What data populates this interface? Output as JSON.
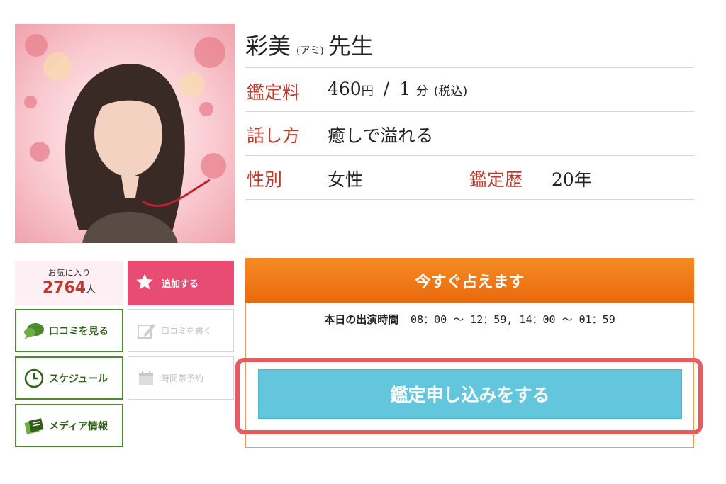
{
  "profile": {
    "name": "彩美",
    "reading": "(アミ)",
    "honorific": "先生",
    "fee_label": "鑑定料",
    "fee_price": "460",
    "fee_currency": "円",
    "fee_slash": "/",
    "fee_minutes": "1",
    "fee_unit": "分",
    "fee_tax": "(税込)",
    "style_label": "話し方",
    "style_value": "癒しで溢れる",
    "gender_label": "性別",
    "gender_value": "女性",
    "experience_label": "鑑定歴",
    "experience_value": "20年"
  },
  "favorites": {
    "label": "お気に入り",
    "count": "2764",
    "unit": "人",
    "add_label": "追加する"
  },
  "buttons": {
    "reviews_view": "口コミを見る",
    "reviews_write": "口コミを書く",
    "schedule": "スケジュール",
    "time_reserve": "時間帯予約",
    "media": "メディア情報"
  },
  "booking": {
    "banner": "今すぐ占えます",
    "hours_label": "本日の出演時間",
    "hours_value": "08：00 〜 12：59,  14：00 〜 01：59",
    "apply_label": "鑑定申し込みをする"
  },
  "colors": {
    "accent_red": "#c0392b",
    "pink_button": "#e84c73",
    "green_border": "#4e8a32",
    "orange_banner": "#f07a1a",
    "apply_blue": "#64c6dc",
    "highlight": "#ea5b60"
  }
}
